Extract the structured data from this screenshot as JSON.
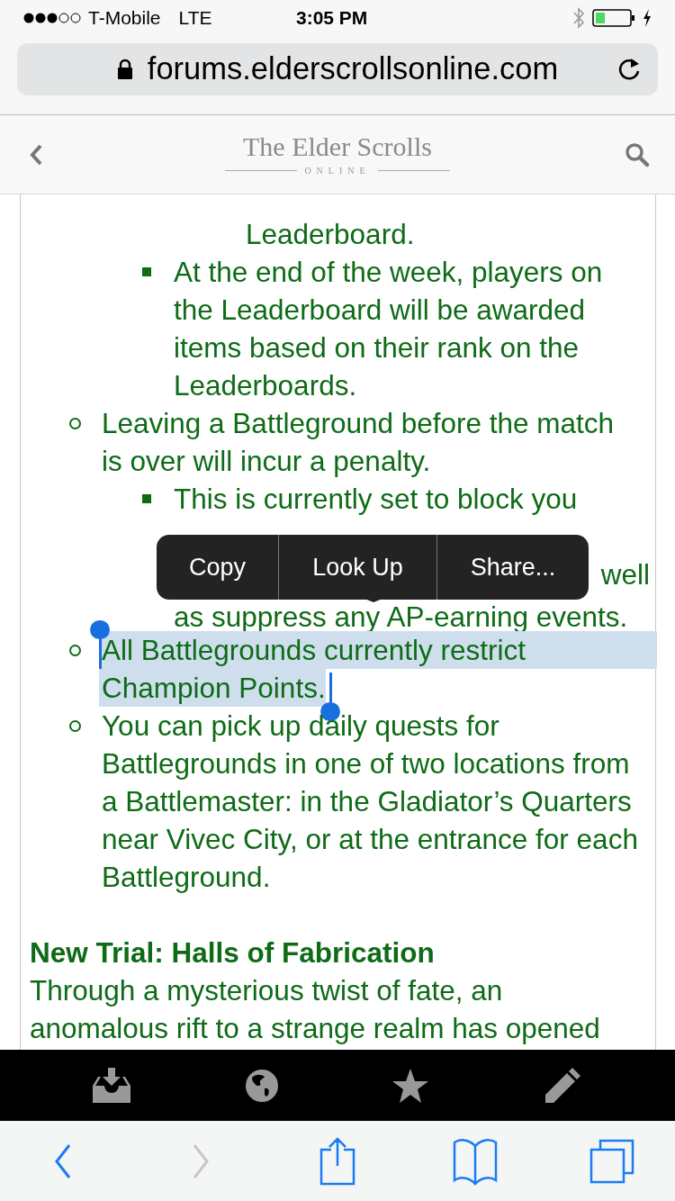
{
  "status_bar": {
    "carrier": "T-Mobile",
    "network": "LTE",
    "time": "3:05 PM"
  },
  "address_bar": {
    "url": "forums.elderscrollsonline.com"
  },
  "site_header": {
    "logo_title": "The Elder Scrolls",
    "logo_subtitle": "ONLINE"
  },
  "article": {
    "list": [
      {
        "children": [
          {
            "children": [
              {
                "lines": [
                  "Leaderboard."
                ]
              }
            ]
          },
          {
            "bullet": true,
            "lines": [
              "At the end of the week, players on",
              "the Leaderboard will be awarded",
              "items based on their rank on the",
              "Leaderboards."
            ]
          }
        ]
      },
      {
        "bullet": true,
        "lines": [
          "Leaving a Battleground before the match",
          "is over will incur a penalty."
        ],
        "children": [
          {
            "bullet": true,
            "lines": [
              "This is currently set to block you",
              {
                "text": "well",
                "kind": "tail"
              },
              "as suppress any AP-earning events."
            ]
          }
        ]
      },
      {
        "bullet": true,
        "selected": true,
        "lines": [
          "All Battlegrounds currently restrict",
          "Champion Points."
        ]
      },
      {
        "bullet": true,
        "lines": [
          "You can pick up daily quests for",
          "Battlegrounds in one of two locations from",
          "a Battlemaster: in the Gladiator’s Quarters",
          "near Vivec City, or at the entrance for each",
          "Battleground."
        ]
      }
    ],
    "heading": "New Trial: Halls of Fabrication",
    "paragraph_lines": [
      "Through a mysterious twist of fate, an",
      "anomalous rift to a strange realm has opened"
    ]
  },
  "edit_menu": [
    "Copy",
    "Look Up",
    "Share..."
  ],
  "toolbar": [
    {
      "kind": "back",
      "disabled": false
    },
    {
      "kind": "forward",
      "disabled": true
    },
    {
      "kind": "share",
      "disabled": false
    },
    {
      "kind": "bookmarks",
      "disabled": false
    },
    {
      "kind": "tabs",
      "disabled": false
    }
  ]
}
